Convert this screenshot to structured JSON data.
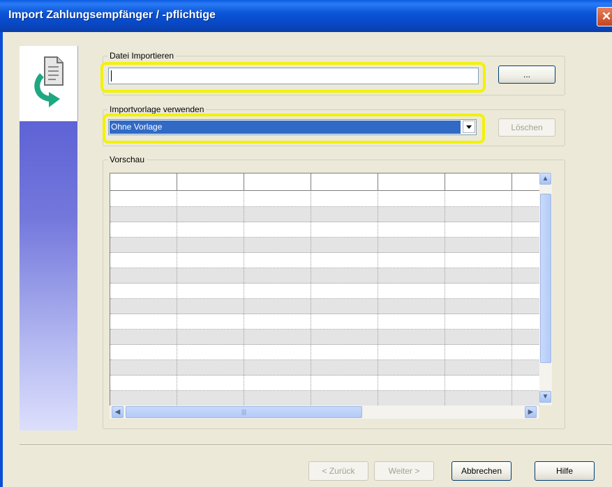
{
  "window": {
    "title": "Import Zahlungsempfänger / -pflichtige",
    "close_label": "✕"
  },
  "file_group": {
    "legend": "Datei Importieren",
    "input_value": "",
    "browse_label": "..."
  },
  "template_group": {
    "legend": "Importvorlage verwenden",
    "selected": "Ohne Vorlage",
    "delete_label": "Löschen"
  },
  "preview_group": {
    "legend": "Vorschau",
    "columns": [
      "",
      "",
      "",
      "",
      "",
      "",
      ""
    ],
    "row_count": 14
  },
  "scrollbars": {
    "up": "▲",
    "down": "▼",
    "left": "◀",
    "right": "▶",
    "grip": "|||"
  },
  "footer": {
    "back_label": "< Zurück",
    "next_label": "Weiter >",
    "cancel_label": "Abbrechen",
    "help_label": "Hilfe"
  },
  "colors": {
    "title_bar": "#0a56d8",
    "highlight": "#f2f20a",
    "selection": "#316ac5",
    "side_panel": "#5b5fd4"
  },
  "icons": {
    "side": "document-import-arrow-icon"
  }
}
